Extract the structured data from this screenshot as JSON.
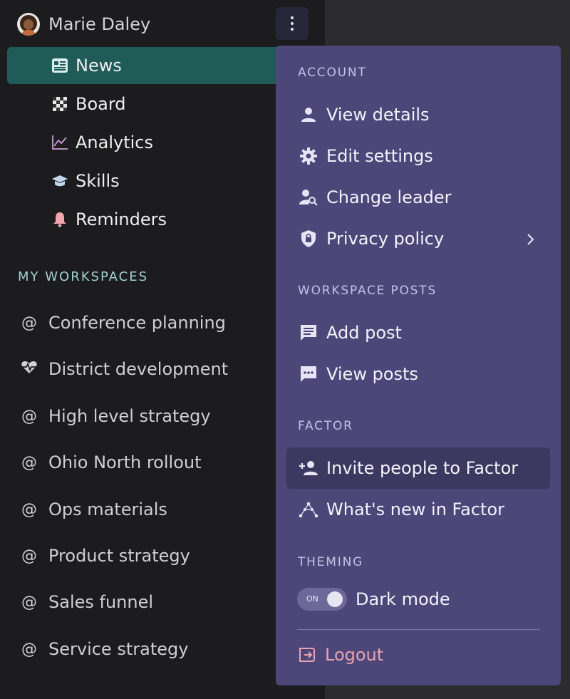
{
  "user": {
    "name": "Marie Daley"
  },
  "nav": {
    "items": [
      {
        "label": "News",
        "icon": "newspaper-icon",
        "active": true
      },
      {
        "label": "Board",
        "icon": "checkerboard-icon"
      },
      {
        "label": "Analytics",
        "icon": "chart-line-icon"
      },
      {
        "label": "Skills",
        "icon": "graduation-cap-icon"
      },
      {
        "label": "Reminders",
        "icon": "bell-icon"
      }
    ]
  },
  "workspaces": {
    "header": "MY WORKSPACES",
    "items": [
      {
        "label": "Conference planning",
        "icon": "at-icon"
      },
      {
        "label": "District development",
        "icon": "heartbeat-icon"
      },
      {
        "label": "High level strategy",
        "icon": "at-icon"
      },
      {
        "label": "Ohio North rollout",
        "icon": "at-icon"
      },
      {
        "label": "Ops materials",
        "icon": "at-icon"
      },
      {
        "label": "Product strategy",
        "icon": "at-icon"
      },
      {
        "label": "Sales funnel",
        "icon": "at-icon"
      },
      {
        "label": "Service strategy",
        "icon": "at-icon"
      }
    ]
  },
  "menu": {
    "account": {
      "header": "ACCOUNT",
      "view_details": "View details",
      "edit_settings": "Edit settings",
      "change_leader": "Change leader",
      "privacy_policy": "Privacy policy"
    },
    "posts": {
      "header": "WORKSPACE POSTS",
      "add_post": "Add post",
      "view_posts": "View posts"
    },
    "factor": {
      "header": "FACTOR",
      "invite": "Invite people to Factor",
      "whats_new": "What's new in Factor"
    },
    "theming": {
      "header": "THEMING",
      "toggle_state": "ON",
      "dark_mode": "Dark mode"
    },
    "logout": "Logout"
  },
  "colors": {
    "sidebar_bg": "#1c1c1e",
    "active_nav": "#1f5b57",
    "menu_bg": "#4c4679",
    "menu_hover": "#3d385f",
    "logout": "#e6a3b4",
    "workspace_header": "#9fd2cf"
  }
}
